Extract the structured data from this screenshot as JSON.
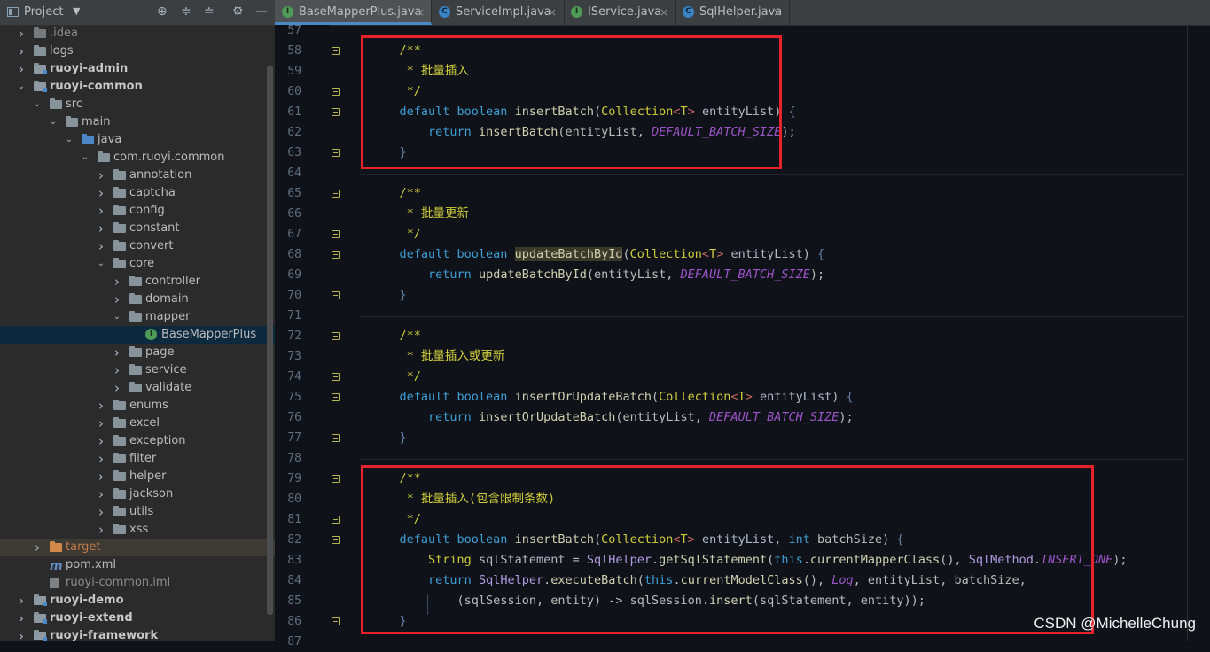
{
  "project_panel": {
    "title": "Project",
    "header_icons": [
      "crosshair-icon",
      "collapse-all-icon",
      "expand-all-icon",
      "gear-icon",
      "minimize-icon"
    ],
    "tree": [
      {
        "label": ".idea",
        "depth": 0,
        "expand": "collapsed",
        "icon": "folder-idea",
        "style": "gray"
      },
      {
        "label": "logs",
        "depth": 0,
        "expand": "collapsed",
        "icon": "folder",
        "style": "normal"
      },
      {
        "label": "ruoyi-admin",
        "depth": 0,
        "expand": "collapsed",
        "icon": "module",
        "style": "bold"
      },
      {
        "label": "ruoyi-common",
        "depth": 0,
        "expand": "expanded",
        "icon": "module",
        "style": "bold"
      },
      {
        "label": "src",
        "depth": 1,
        "expand": "expanded",
        "icon": "folder",
        "style": "normal"
      },
      {
        "label": "main",
        "depth": 2,
        "expand": "expanded",
        "icon": "folder",
        "style": "normal"
      },
      {
        "label": "java",
        "depth": 3,
        "expand": "expanded",
        "icon": "source-root",
        "style": "normal"
      },
      {
        "label": "com.ruoyi.common",
        "depth": 4,
        "expand": "expanded",
        "icon": "package",
        "style": "normal"
      },
      {
        "label": "annotation",
        "depth": 5,
        "expand": "collapsed",
        "icon": "package",
        "style": "normal"
      },
      {
        "label": "captcha",
        "depth": 5,
        "expand": "collapsed",
        "icon": "package",
        "style": "normal"
      },
      {
        "label": "config",
        "depth": 5,
        "expand": "collapsed",
        "icon": "package",
        "style": "normal"
      },
      {
        "label": "constant",
        "depth": 5,
        "expand": "collapsed",
        "icon": "package",
        "style": "normal"
      },
      {
        "label": "convert",
        "depth": 5,
        "expand": "collapsed",
        "icon": "package",
        "style": "normal"
      },
      {
        "label": "core",
        "depth": 5,
        "expand": "expanded",
        "icon": "package",
        "style": "normal"
      },
      {
        "label": "controller",
        "depth": 6,
        "expand": "collapsed",
        "icon": "package",
        "style": "normal"
      },
      {
        "label": "domain",
        "depth": 6,
        "expand": "collapsed",
        "icon": "package",
        "style": "normal"
      },
      {
        "label": "mapper",
        "depth": 6,
        "expand": "expanded",
        "icon": "package",
        "style": "normal"
      },
      {
        "label": "BaseMapperPlus",
        "depth": 7,
        "expand": "none",
        "icon": "interface",
        "style": "selected"
      },
      {
        "label": "page",
        "depth": 6,
        "expand": "collapsed",
        "icon": "package",
        "style": "normal"
      },
      {
        "label": "service",
        "depth": 6,
        "expand": "collapsed",
        "icon": "package",
        "style": "normal"
      },
      {
        "label": "validate",
        "depth": 6,
        "expand": "collapsed",
        "icon": "package",
        "style": "normal"
      },
      {
        "label": "enums",
        "depth": 5,
        "expand": "collapsed",
        "icon": "package",
        "style": "normal"
      },
      {
        "label": "excel",
        "depth": 5,
        "expand": "collapsed",
        "icon": "package",
        "style": "normal"
      },
      {
        "label": "exception",
        "depth": 5,
        "expand": "collapsed",
        "icon": "package",
        "style": "normal"
      },
      {
        "label": "filter",
        "depth": 5,
        "expand": "collapsed",
        "icon": "package",
        "style": "normal"
      },
      {
        "label": "helper",
        "depth": 5,
        "expand": "collapsed",
        "icon": "package",
        "style": "normal"
      },
      {
        "label": "jackson",
        "depth": 5,
        "expand": "collapsed",
        "icon": "package",
        "style": "normal"
      },
      {
        "label": "utils",
        "depth": 5,
        "expand": "collapsed",
        "icon": "package",
        "style": "normal"
      },
      {
        "label": "xss",
        "depth": 5,
        "expand": "collapsed",
        "icon": "package",
        "style": "normal"
      },
      {
        "label": "target",
        "depth": 1,
        "expand": "collapsed",
        "icon": "folder-excluded",
        "style": "excluded"
      },
      {
        "label": "pom.xml",
        "depth": 1,
        "expand": "none",
        "icon": "maven-file",
        "style": "normal"
      },
      {
        "label": "ruoyi-common.iml",
        "depth": 1,
        "expand": "none",
        "icon": "iml-file",
        "style": "gray"
      },
      {
        "label": "ruoyi-demo",
        "depth": 0,
        "expand": "collapsed",
        "icon": "module",
        "style": "bold"
      },
      {
        "label": "ruoyi-extend",
        "depth": 0,
        "expand": "collapsed",
        "icon": "module",
        "style": "bold"
      },
      {
        "label": "ruoyi-framework",
        "depth": 0,
        "expand": "collapsed",
        "icon": "module",
        "style": "bold"
      }
    ]
  },
  "tabs": [
    {
      "label": "BaseMapperPlus.java",
      "icon": "interface-icon",
      "active": true
    },
    {
      "label": "ServiceImpl.java",
      "icon": "class-icon",
      "active": false
    },
    {
      "label": "IService.java",
      "icon": "interface-icon",
      "active": false
    },
    {
      "label": "SqlHelper.java",
      "icon": "class-icon",
      "active": false
    }
  ],
  "close_glyph": "×",
  "editor": {
    "lines": [
      {
        "n": "57",
        "code": []
      },
      {
        "n": "58",
        "fold": true,
        "code": [
          [
            "    ",
            ""
          ],
          [
            "/**",
            "cm"
          ]
        ]
      },
      {
        "n": "59",
        "code": [
          [
            "     * 批量插入",
            "cm"
          ]
        ]
      },
      {
        "n": "60",
        "fold": true,
        "code": [
          [
            "     */",
            "cm"
          ]
        ]
      },
      {
        "n": "61",
        "fold": true,
        "code": [
          [
            "    ",
            ""
          ],
          [
            "default boolean ",
            "kw"
          ],
          [
            "insertBatch",
            "mt"
          ],
          [
            "(",
            ""
          ],
          [
            "Collection",
            "ty"
          ],
          [
            "<",
            "gen"
          ],
          [
            "T",
            "ty"
          ],
          [
            "> ",
            "gen"
          ],
          [
            "entityList",
            "par"
          ],
          [
            ") ",
            ""
          ],
          [
            "{",
            "brk"
          ]
        ]
      },
      {
        "n": "62",
        "code": [
          [
            "        ",
            ""
          ],
          [
            "return ",
            "kw"
          ],
          [
            "insertBatch",
            "mt"
          ],
          [
            "(entityList, ",
            ""
          ],
          [
            "DEFAULT_BATCH_SIZE",
            "cn"
          ],
          [
            ");",
            ""
          ]
        ]
      },
      {
        "n": "63",
        "fold": true,
        "code": [
          [
            "    ",
            ""
          ],
          [
            "}",
            "brk"
          ]
        ]
      },
      {
        "n": "64",
        "code": [],
        "sep": true
      },
      {
        "n": "65",
        "fold": true,
        "code": [
          [
            "    ",
            ""
          ],
          [
            "/**",
            "cm"
          ]
        ]
      },
      {
        "n": "66",
        "code": [
          [
            "     * 批量更新",
            "cm"
          ]
        ]
      },
      {
        "n": "67",
        "fold": true,
        "code": [
          [
            "     */",
            "cm"
          ]
        ]
      },
      {
        "n": "68",
        "fold": true,
        "code": [
          [
            "    ",
            ""
          ],
          [
            "default boolean ",
            "kw"
          ],
          [
            "updateBatchById",
            "mt hl"
          ],
          [
            "(",
            ""
          ],
          [
            "Collection",
            "ty"
          ],
          [
            "<",
            "gen"
          ],
          [
            "T",
            "ty"
          ],
          [
            "> ",
            "gen"
          ],
          [
            "entityList",
            "par"
          ],
          [
            ") ",
            ""
          ],
          [
            "{",
            "brk"
          ]
        ]
      },
      {
        "n": "69",
        "code": [
          [
            "        ",
            ""
          ],
          [
            "return ",
            "kw"
          ],
          [
            "updateBatchById",
            "mt"
          ],
          [
            "(entityList, ",
            ""
          ],
          [
            "DEFAULT_BATCH_SIZE",
            "cn"
          ],
          [
            ");",
            ""
          ]
        ]
      },
      {
        "n": "70",
        "fold": true,
        "code": [
          [
            "    ",
            ""
          ],
          [
            "}",
            "brk"
          ]
        ]
      },
      {
        "n": "71",
        "code": [],
        "sep": true
      },
      {
        "n": "72",
        "fold": true,
        "code": [
          [
            "    ",
            ""
          ],
          [
            "/**",
            "cm"
          ]
        ]
      },
      {
        "n": "73",
        "code": [
          [
            "     * 批量插入或更新",
            "cm"
          ]
        ]
      },
      {
        "n": "74",
        "fold": true,
        "code": [
          [
            "     */",
            "cm"
          ]
        ]
      },
      {
        "n": "75",
        "fold": true,
        "code": [
          [
            "    ",
            ""
          ],
          [
            "default boolean ",
            "kw"
          ],
          [
            "insertOrUpdateBatch",
            "mt"
          ],
          [
            "(",
            ""
          ],
          [
            "Collection",
            "ty"
          ],
          [
            "<",
            "gen"
          ],
          [
            "T",
            "ty"
          ],
          [
            "> ",
            "gen"
          ],
          [
            "entityList",
            "par"
          ],
          [
            ") ",
            ""
          ],
          [
            "{",
            "brk"
          ]
        ]
      },
      {
        "n": "76",
        "code": [
          [
            "        ",
            ""
          ],
          [
            "return ",
            "kw"
          ],
          [
            "insertOrUpdateBatch",
            "mt"
          ],
          [
            "(entityList, ",
            ""
          ],
          [
            "DEFAULT_BATCH_SIZE",
            "cn"
          ],
          [
            ");",
            ""
          ]
        ]
      },
      {
        "n": "77",
        "fold": true,
        "code": [
          [
            "    ",
            ""
          ],
          [
            "}",
            "brk"
          ]
        ]
      },
      {
        "n": "78",
        "code": [],
        "sep": true
      },
      {
        "n": "79",
        "fold": true,
        "code": [
          [
            "    ",
            ""
          ],
          [
            "/**",
            "cm"
          ]
        ]
      },
      {
        "n": "80",
        "code": [
          [
            "     * 批量插入(包含限制条数)",
            "cm"
          ]
        ]
      },
      {
        "n": "81",
        "fold": true,
        "code": [
          [
            "     */",
            "cm"
          ]
        ]
      },
      {
        "n": "82",
        "fold": true,
        "code": [
          [
            "    ",
            ""
          ],
          [
            "default boolean ",
            "kw"
          ],
          [
            "insertBatch",
            "mt"
          ],
          [
            "(",
            ""
          ],
          [
            "Collection",
            "ty"
          ],
          [
            "<",
            "gen"
          ],
          [
            "T",
            "ty"
          ],
          [
            "> ",
            "gen"
          ],
          [
            "entityList, ",
            "par"
          ],
          [
            "int ",
            "kw"
          ],
          [
            "batchSize",
            ""
          ],
          [
            ") ",
            ""
          ],
          [
            "{",
            "brk"
          ]
        ]
      },
      {
        "n": "83",
        "code": [
          [
            "        ",
            ""
          ],
          [
            "String ",
            "ty"
          ],
          [
            "sqlStatement = ",
            "par"
          ],
          [
            "SqlHelper",
            "cls"
          ],
          [
            ".",
            ""
          ],
          [
            "getSqlStatement",
            "mt"
          ],
          [
            "(",
            ""
          ],
          [
            "this",
            "kw"
          ],
          [
            ".",
            ""
          ],
          [
            "currentMapperClass",
            "mt"
          ],
          [
            "(), ",
            ""
          ],
          [
            "SqlMethod",
            "cls"
          ],
          [
            ".",
            ""
          ],
          [
            "INSERT_ONE",
            "cn"
          ],
          [
            ");",
            ""
          ]
        ]
      },
      {
        "n": "84",
        "code": [
          [
            "        ",
            ""
          ],
          [
            "return ",
            "kw"
          ],
          [
            "SqlHelper",
            "cls"
          ],
          [
            ".",
            ""
          ],
          [
            "executeBatch",
            "mt"
          ],
          [
            "(",
            ""
          ],
          [
            "this",
            "kw"
          ],
          [
            ".",
            ""
          ],
          [
            "currentModelClass",
            "mt"
          ],
          [
            "(), ",
            ""
          ],
          [
            "Log",
            "cn"
          ],
          [
            ", entityList, batchSize,",
            ""
          ]
        ]
      },
      {
        "n": "85",
        "code": [
          [
            "            ",
            ""
          ],
          [
            "(sqlSession, entity) -> sqlSession.",
            ""
          ],
          [
            "insert",
            "mt"
          ],
          [
            "(sqlStatement, entity));",
            ""
          ]
        ]
      },
      {
        "n": "86",
        "fold": true,
        "code": [
          [
            "    ",
            ""
          ],
          [
            "}",
            "brk"
          ]
        ]
      },
      {
        "n": "87",
        "code": []
      }
    ]
  },
  "colors": {
    "highlight_box": "#e8222b",
    "keyword": "#3f9ed5",
    "comment": "#cfcc3d",
    "constant": "#9c54c8"
  },
  "watermark": "CSDN @MichelleChung"
}
